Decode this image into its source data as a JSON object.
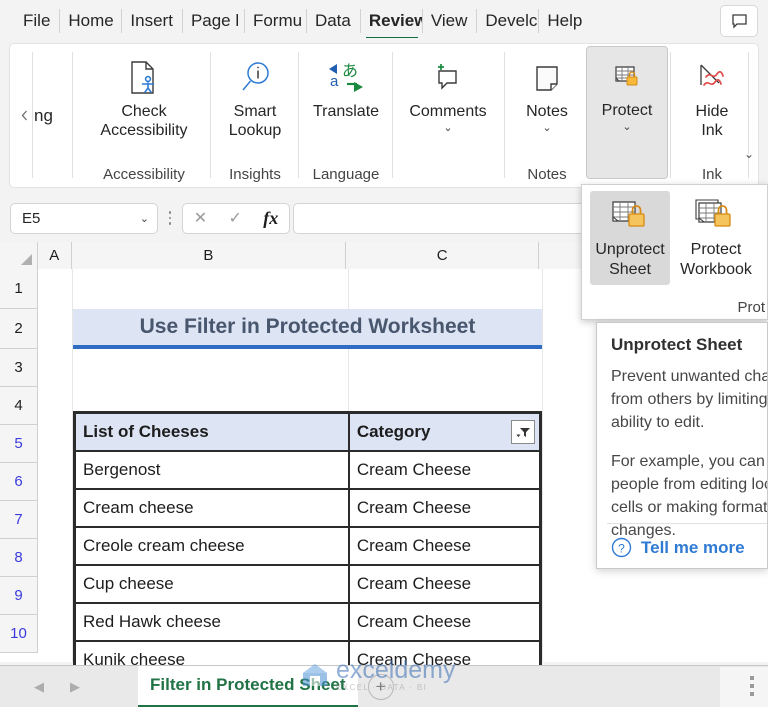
{
  "ribbon_tabs": [
    {
      "label": "File",
      "active": false
    },
    {
      "label": "Home",
      "active": false
    },
    {
      "label": "Insert",
      "active": false
    },
    {
      "label": "Page l",
      "active": false
    },
    {
      "label": "Formu",
      "active": false
    },
    {
      "label": "Data",
      "active": false
    },
    {
      "label": "Review",
      "active": true
    },
    {
      "label": "View",
      "active": false
    },
    {
      "label": "Develс",
      "active": false
    },
    {
      "label": "Help",
      "active": false
    }
  ],
  "comment_button": {
    "icon": "comment-icon"
  },
  "ribbon": {
    "scroll_left_icon": "chevron-left-icon",
    "partial_group_label": "ng",
    "expand_icon": "chevron-down-icon",
    "groups": [
      {
        "group_label": "Accessibility",
        "buttons": [
          {
            "label": "Check Accessibility",
            "icon": "check-accessibility-icon",
            "has_caret": true,
            "selected": false
          }
        ]
      },
      {
        "group_label": "Insights",
        "buttons": [
          {
            "label": "Smart Lookup",
            "icon": "smart-lookup-icon",
            "has_caret": false,
            "selected": false
          }
        ]
      },
      {
        "group_label": "Language",
        "buttons": [
          {
            "label": "Translate",
            "icon": "translate-icon",
            "has_caret": false,
            "selected": false
          }
        ]
      },
      {
        "group_label": "",
        "buttons": [
          {
            "label": "Comments",
            "icon": "new-comment-icon",
            "has_caret": true,
            "selected": false
          }
        ]
      },
      {
        "group_label": "Notes",
        "buttons": [
          {
            "label": "Notes",
            "icon": "notes-icon",
            "has_caret": true,
            "selected": false
          }
        ]
      },
      {
        "group_label": "",
        "buttons": [
          {
            "label": "Protect",
            "icon": "protect-sheet-icon",
            "has_caret": true,
            "selected": true
          }
        ]
      },
      {
        "group_label": "Ink",
        "buttons": [
          {
            "label": "Hide Ink",
            "icon": "hide-ink-icon",
            "has_caret": true,
            "selected": false
          }
        ]
      }
    ]
  },
  "formula_bar": {
    "name_box_value": "E5",
    "name_box_caret_icon": "chevron-down-icon",
    "more_icon": "vertical-dots-icon",
    "cancel_icon": "cancel-x-icon",
    "confirm_icon": "confirm-check-icon",
    "function_icon": "fx-icon",
    "formula_value": "",
    "formula_placeholder": ""
  },
  "sheet": {
    "column_headers": [
      "A",
      "B",
      "C"
    ],
    "row_headers": [
      "1",
      "2",
      "3",
      "4",
      "5",
      "6",
      "7",
      "8",
      "9",
      "10"
    ],
    "selected_rows": [
      "5",
      "6",
      "7",
      "8",
      "9",
      "10"
    ],
    "title_cell": "Use Filter in Protected Worksheet",
    "table": {
      "headers": [
        "List of Cheeses",
        "Category"
      ],
      "filter_icon": "filter-dropdown-icon",
      "rows": [
        [
          "Bergenost",
          "Cream Cheese"
        ],
        [
          "Cream cheese",
          "Cream Cheese"
        ],
        [
          "Creole cream cheese",
          "Cream Cheese"
        ],
        [
          "Cup cheese",
          "Cream Cheese"
        ],
        [
          "Red Hawk cheese",
          "Cream Cheese"
        ],
        [
          "Kunik cheese",
          "Cream Cheese"
        ]
      ]
    },
    "colors": {
      "title_bg": "#dde4f3",
      "title_text": "#49576e",
      "title_underline": "#2f6cc4",
      "header_bg": "#dde4f3",
      "border": "#2b2b2b"
    }
  },
  "protect_dropdown": {
    "items": [
      {
        "label": "Unprotect Sheet",
        "icon": "unprotect-sheet-icon",
        "hovered": true
      },
      {
        "label": "Protect Workbook",
        "icon": "protect-workbook-icon",
        "hovered": false
      }
    ],
    "group_label": "Prot"
  },
  "tooltip": {
    "title": "Unprotect Sheet",
    "paragraphs": [
      "Prevent unwanted changes from others by limiting their ability to edit.",
      "For example, you can stop people from editing locked cells or making formatting changes."
    ],
    "help_icon": "question-circle-icon",
    "link_text": "Tell me more"
  },
  "sheet_tabs": {
    "prev_icon": "triangle-left-icon",
    "next_icon": "triangle-right-icon",
    "tabs": [
      {
        "label": "Filter in Protected Sheet",
        "active": true
      }
    ],
    "add_sheet_icon": "plus-icon",
    "more_icon": "vertical-dots-icon"
  },
  "watermark": {
    "logo_icon": "exceldemy-logo-icon",
    "main": "exceldemy",
    "sub": "EXCEL · DATA · BI"
  }
}
